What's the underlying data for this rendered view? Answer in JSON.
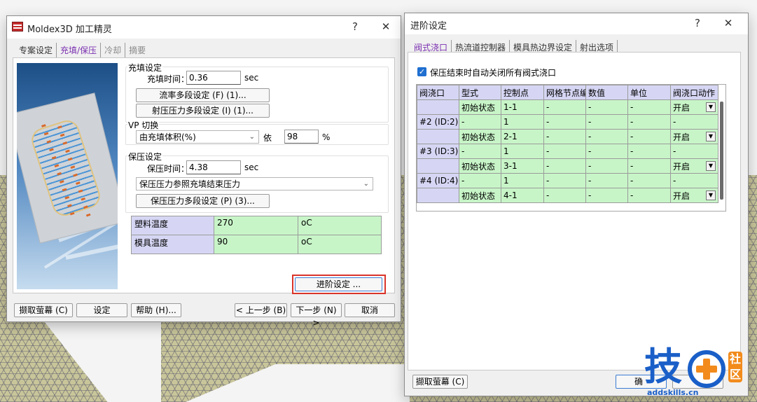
{
  "wizard": {
    "title": "Moldex3D 加工精灵",
    "help_btn": "?",
    "close_btn": "✕",
    "tabs": [
      {
        "label": "专案设定",
        "style": "normal"
      },
      {
        "label": "充填/保压",
        "style": "active-link"
      },
      {
        "label": "冷却",
        "style": "disabled"
      },
      {
        "label": "摘要",
        "style": "disabled"
      }
    ],
    "fill": {
      "group_title": "充填设定",
      "time_label": "充填时间：",
      "time_value": "0.36",
      "time_unit": "sec",
      "flow_btn": "流率多段设定 (F) (1)...",
      "pressure_btn": "射压压力多段设定 (I) (1)..."
    },
    "vp": {
      "group_title": "VP 切换",
      "select_value": "由充填体积(%)",
      "by_label": "依",
      "value": "98",
      "unit": "%"
    },
    "pack": {
      "group_title": "保压设定",
      "time_label": "保压时间：",
      "time_value": "4.38",
      "time_unit": "sec",
      "select_value": "保压压力参照充填结束压力",
      "multi_btn": "保压压力多段设定 (P) (3)..."
    },
    "temps": [
      {
        "name": "塑料温度",
        "value": "270",
        "unit": "oC"
      },
      {
        "name": "模具温度",
        "value": "90",
        "unit": "oC"
      }
    ],
    "advanced_btn": "进阶设定 ...",
    "footer": {
      "capture": "撷取萤幕 (C)",
      "settings": "设定",
      "help": "帮助 (H)...",
      "prev": "< 上一步 (B)",
      "next": "下一步 (N) >",
      "cancel": "取消"
    }
  },
  "advanced": {
    "title": "进阶设定",
    "help_btn": "?",
    "close_btn": "✕",
    "tabs": [
      {
        "label": "阀式浇口",
        "style": "active-link"
      },
      {
        "label": "热流道控制器",
        "style": "normal"
      },
      {
        "label": "模具热边界设定",
        "style": "normal"
      },
      {
        "label": "射出选项",
        "style": "normal"
      }
    ],
    "auto_close_label": "保压结束时自动关闭所有阀式浇口",
    "columns": [
      "阀浇口",
      "型式",
      "控制点",
      "网格节点编",
      "数值",
      "单位",
      "阀浇口动作"
    ],
    "rows": [
      {
        "gate": "",
        "type": "初始状态",
        "point": "1-1",
        "node": "-",
        "value": "-",
        "unit": "-",
        "action": "开启",
        "dd": true
      },
      {
        "gate": "#2 (ID:2)",
        "type": "-",
        "point": "1",
        "node": "-",
        "value": "-",
        "unit": "-",
        "action": "-",
        "dd": false
      },
      {
        "gate": "",
        "type": "初始状态",
        "point": "2-1",
        "node": "-",
        "value": "-",
        "unit": "-",
        "action": "开启",
        "dd": true
      },
      {
        "gate": "#3 (ID:3)",
        "type": "-",
        "point": "1",
        "node": "-",
        "value": "-",
        "unit": "-",
        "action": "-",
        "dd": false
      },
      {
        "gate": "",
        "type": "初始状态",
        "point": "3-1",
        "node": "-",
        "value": "-",
        "unit": "-",
        "action": "开启",
        "dd": true
      },
      {
        "gate": "#4 (ID:4)",
        "type": "-",
        "point": "1",
        "node": "-",
        "value": "-",
        "unit": "-",
        "action": "-",
        "dd": false
      },
      {
        "gate": "",
        "type": "初始状态",
        "point": "4-1",
        "node": "-",
        "value": "-",
        "unit": "-",
        "action": "开启",
        "dd": true
      }
    ],
    "footer": {
      "capture": "撷取萤幕 (C)",
      "ok": "确",
      "cancel": "消"
    }
  },
  "watermark": {
    "brand": "技",
    "badge": "社区",
    "url": "addskills.cn"
  }
}
